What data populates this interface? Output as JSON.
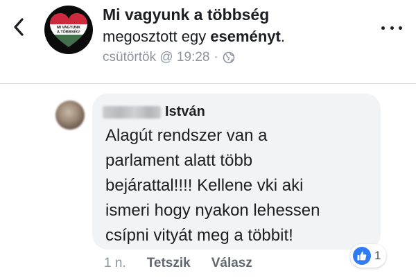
{
  "post_header": {
    "page_name": "Mi vagyunk a többség",
    "shared_prefix": "megosztott egy",
    "shared_object": "eseményt",
    "shared_suffix": ".",
    "timestamp": "csütörtök @ 19:28",
    "separator": "·",
    "audience_icon": "globe-icon",
    "logo_text_line1": "MI VAGYUNK",
    "logo_text_line2": "A TÖBBSÉG!"
  },
  "comment": {
    "author_visible_name": "István",
    "text_lines": [
      "Alagút rendszer van a",
      "parlament alatt több",
      "bejárattal!!!! Kellene vki aki",
      "ismeri hogy nyakon lehessen",
      "csípni vityát meg a többit!"
    ],
    "age": "1 n.",
    "like_label": "Tetszik",
    "reply_label": "Válasz",
    "reaction_count": "1",
    "reaction_icon": "thumbs-up-icon"
  },
  "colors": {
    "accent_blue": "#2f7bf3",
    "bubble_bg": "#f2f3f5",
    "meta_gray": "#8d949e",
    "flag_red": "#cd2a3e",
    "flag_white": "#ffffff",
    "flag_green": "#436f4d"
  }
}
